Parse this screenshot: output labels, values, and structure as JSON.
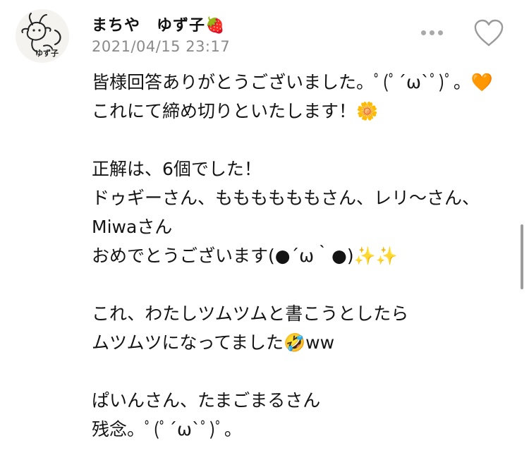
{
  "post": {
    "username": "まちや　ゆず子🍓",
    "timestamp": "2021/04/15 23:17",
    "avatar_icon": "goat-doodle-avatar",
    "avatar_caption": "ゆず子",
    "more_icon": "more-dots-icon",
    "like_icon": "heart-outline-icon",
    "lines": [
      "皆様回答ありがとうございました。ﾟ(ﾟ´ω`ﾟ)ﾟ。🧡",
      "これにて締め切りといたします！🌼",
      "",
      "正解は、6個でした！",
      "ドゥギーさん、ももももももさん、レリ〜さん、",
      "Miwaさん",
      "おめでとうございます(●´ω｀●)✨✨",
      "",
      "これ、わたしツムツムと書こうとしたら",
      "ムツムツになってました🤣ww",
      "",
      "ぱいんさん、たまごまるさん",
      "残念。ﾟ(ﾟ´ω`ﾟ)ﾟ。"
    ]
  }
}
